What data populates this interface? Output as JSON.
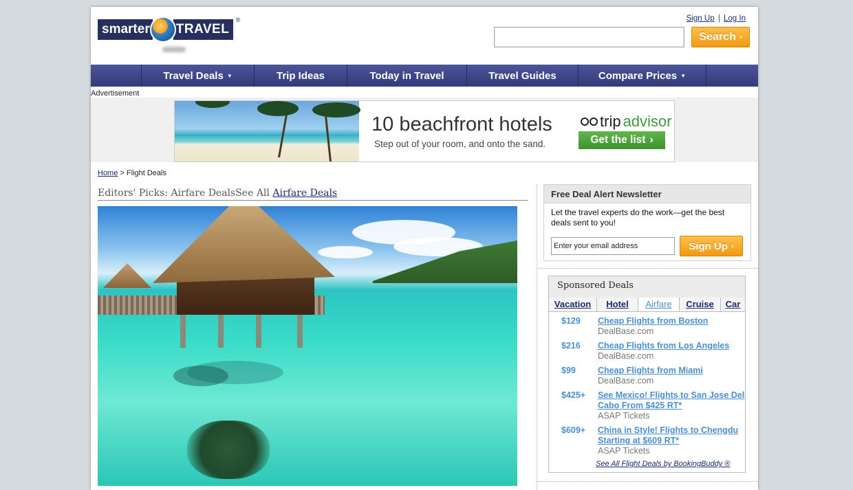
{
  "header": {
    "logo_left": "smarter",
    "logo_right": "TRAVEL",
    "logo_reg": "®",
    "sign_up": "Sign Up",
    "separator": "|",
    "log_in": "Log In",
    "search_value": "",
    "search_button": "Search",
    "chevron": "›"
  },
  "nav": {
    "items": [
      {
        "label": "Travel Deals",
        "has_caret": true
      },
      {
        "label": "Trip Ideas",
        "has_caret": false
      },
      {
        "label": "Today in Travel",
        "has_caret": false
      },
      {
        "label": "Travel Guides",
        "has_caret": false
      },
      {
        "label": "Compare Prices",
        "has_caret": true
      }
    ],
    "caret": "▼"
  },
  "ad": {
    "label": "Advertisement",
    "headline": "10 beachfront hotels",
    "subline": "Step out of your room, and onto the sand.",
    "brand_left": "trip",
    "brand_right": "advisor",
    "cta": "Get the list",
    "cta_arrow": "›"
  },
  "breadcrumb": {
    "home": "Home",
    "sep": ">",
    "current": "Flight Deals"
  },
  "main": {
    "heading": "Editors' Picks: Airfare Deals",
    "see_all_prefix": "See All",
    "see_all_link": "Airfare Deals"
  },
  "newsletter": {
    "title": "Free Deal Alert Newsletter",
    "body": "Let the travel experts do the work—get the best deals sent to you!",
    "email_placeholder": "Enter your email address",
    "button": "Sign Up",
    "arrow": "›"
  },
  "sponsored": {
    "title": "Sponsored Deals",
    "tabs": [
      "Vacation",
      "Hotel",
      "Airfare",
      "Cruise",
      "Car"
    ],
    "active_tab": "Airfare",
    "deals": [
      {
        "price": "$129",
        "title": "Cheap Flights from Boston",
        "source": "DealBase.com"
      },
      {
        "price": "$216",
        "title": "Cheap Flights from Los Angeles",
        "source": "DealBase.com"
      },
      {
        "price": "$99",
        "title": "Cheap Flights from Miami",
        "source": "DealBase.com"
      },
      {
        "price": "$425+",
        "title": "See Mexico! Flights to San Jose Del Cabo From $425 RT*",
        "source": "ASAP Tickets"
      },
      {
        "price": "$609+",
        "title": "China in Style! Flights to Chengdu Starting at $609 RT*",
        "source": "ASAP Tickets"
      }
    ],
    "see_all": "See All Flight Deals by BookingBuddy ®"
  },
  "colors": {
    "nav": "#3d4488",
    "accent_orange": "#f5a623",
    "link_blue": "#4b8fd0",
    "tripadvisor_green": "#3d9a3b"
  }
}
